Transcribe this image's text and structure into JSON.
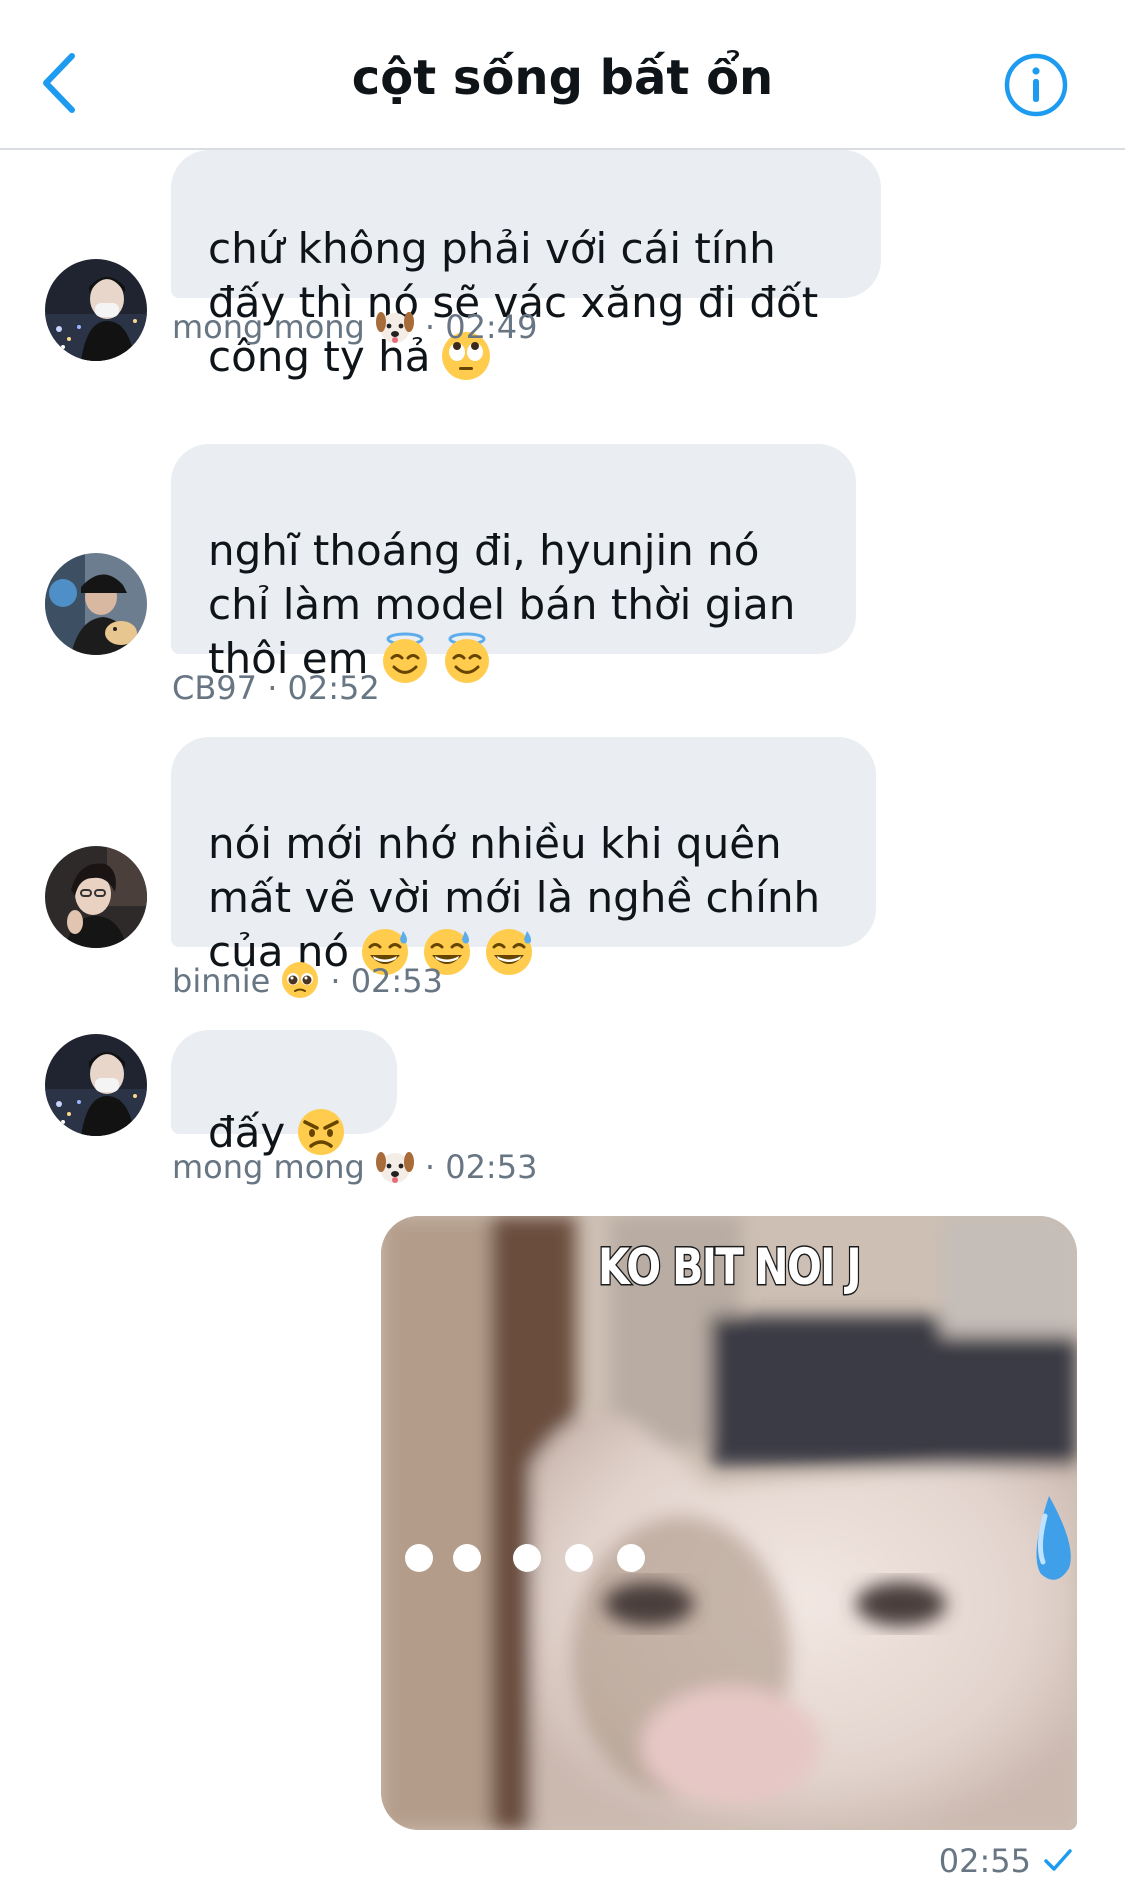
{
  "header": {
    "title": "cột sống bất ổn",
    "back_icon": "chevron-left-icon",
    "info_icon": "info-icon",
    "accent_color": "#1d9bf0"
  },
  "messages": [
    {
      "sender": "mong mong",
      "sender_emoji": "dog-face-icon",
      "time": "02:49",
      "text": "chứ không phải với cái tính\nđấy thì nó sẽ vác xăng đi đốt\ncông ty hả",
      "emojis": [
        "rolling-eyes-icon"
      ]
    },
    {
      "sender": "CB97",
      "time": "02:52",
      "text": "nghĩ thoáng đi, hyunjin nó\nchỉ làm model bán thời gian\nthôi em",
      "emojis": [
        "halo-face-icon",
        "halo-face-icon"
      ]
    },
    {
      "sender": "binnie",
      "sender_emoji": "pleading-face-icon",
      "time": "02:53",
      "text": "nói mới nhớ nhiều khi quên\nmất vẽ vời mới là nghề chính\ncủa nó",
      "emojis": [
        "sweat-smile-icon",
        "sweat-smile-icon",
        "sweat-smile-icon"
      ]
    },
    {
      "sender": "mong mong",
      "sender_emoji": "dog-face-icon",
      "time": "02:53",
      "text": "đấy",
      "emojis": [
        "angry-face-icon"
      ]
    }
  ],
  "sent_image": {
    "caption": "KO BIT NOI J",
    "time": "02:55",
    "status_icon": "check-icon"
  },
  "colors": {
    "bubble": "#eaedf2",
    "meta_text": "#687684",
    "accent": "#1d9bf0"
  }
}
